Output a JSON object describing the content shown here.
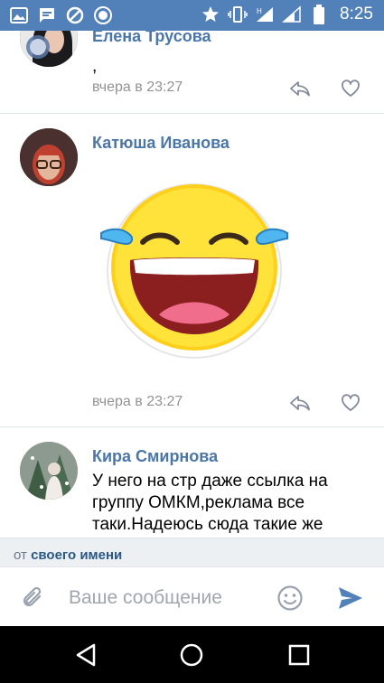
{
  "status_bar": {
    "time": "8:25",
    "left_icons": [
      "image-icon",
      "message-icon",
      "blocked-icon",
      "vk-icon"
    ],
    "right_icons": [
      "star-icon",
      "vibrate-icon",
      "signal-h-icon",
      "signal-icon",
      "battery-icon"
    ]
  },
  "comments": [
    {
      "author": "Елена Трусова",
      "text": ",",
      "time": "вчера в 23:27"
    },
    {
      "author": "Катюша Иванова",
      "sticker": "laughing-tears-emoji",
      "time": "вчера в 23:27"
    },
    {
      "author": "Кира Смирнова",
      "text": "У него на стр даже ссылка на группу ОМКМ,реклама все таки.Надеюсь сюда такие же"
    }
  ],
  "reply_as": {
    "prefix": "от",
    "link": "своего имени"
  },
  "composer": {
    "placeholder": "Ваше сообщение",
    "value": ""
  },
  "colors": {
    "status_bar": "#5181b8",
    "author": "#4a76a8",
    "meta": "#939393",
    "accent": "#5181b8",
    "nav_bar": "#000000"
  }
}
